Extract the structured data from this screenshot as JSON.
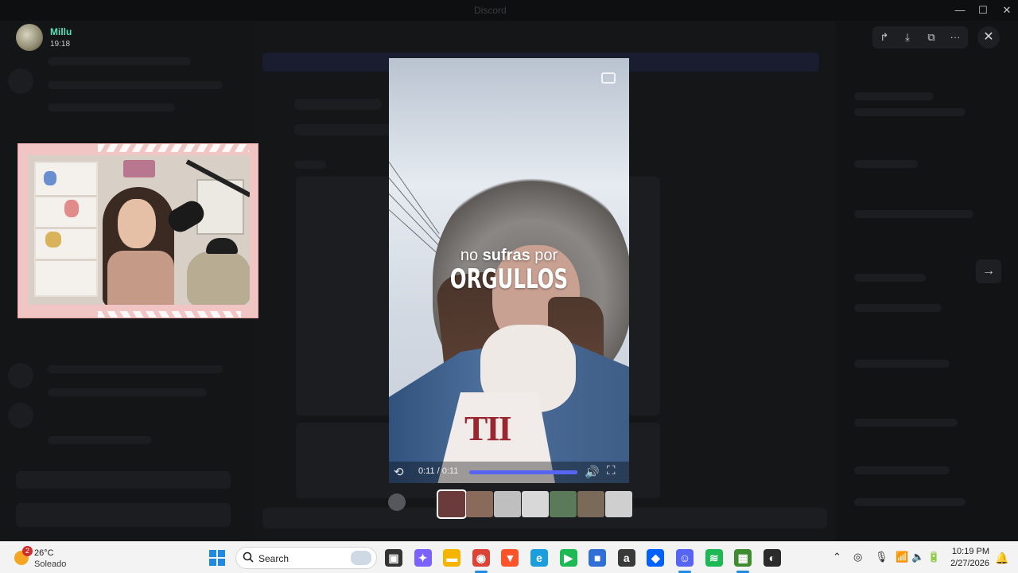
{
  "window": {
    "title": "Discord",
    "minimize": "—",
    "maximize": "☐",
    "close": "✕"
  },
  "uploader": {
    "name": "Millu",
    "time": "19:18"
  },
  "viewer": {
    "toolbar": {
      "forward": "↱",
      "download": "⤓",
      "open_external": "⧉",
      "more": "···"
    },
    "close": "✕",
    "next": "→"
  },
  "video": {
    "caption_line1_a": "no",
    "caption_line1_b": "sufras",
    "caption_line1_c": "por",
    "caption_line2": "ORGULLOS",
    "shirt_text": "TII",
    "current_time": "0:11",
    "duration": "0:11",
    "time_display": "0:11 / 0:11",
    "progress": 1.0
  },
  "thumbnails": [
    {
      "name": "thumb-1",
      "color": "#6b3b3b",
      "active": true
    },
    {
      "name": "thumb-2",
      "color": "#8a6a5a",
      "active": false
    },
    {
      "name": "thumb-3",
      "color": "#bfbfbf",
      "active": false
    },
    {
      "name": "thumb-4",
      "color": "#d8d8d8",
      "active": false
    },
    {
      "name": "thumb-5",
      "color": "#5a7a5a",
      "active": false
    },
    {
      "name": "thumb-6",
      "color": "#7a6a5a",
      "active": false
    },
    {
      "name": "thumb-7",
      "color": "#cfcfcf",
      "active": false
    }
  ],
  "taskbar": {
    "weather": {
      "badge": "2",
      "temp": "26°C",
      "condition": "Soleado"
    },
    "search_placeholder": "Search",
    "apps": [
      {
        "name": "task-view-icon",
        "color": "#333333",
        "glyph": "▣"
      },
      {
        "name": "copilot-icon",
        "color": "#7b61ff",
        "glyph": "✦"
      },
      {
        "name": "file-explorer-icon",
        "color": "#f4b400",
        "glyph": "▬"
      },
      {
        "name": "chrome-icon",
        "color": "#db4437",
        "glyph": "◉"
      },
      {
        "name": "brave-icon",
        "color": "#fb542b",
        "glyph": "▼"
      },
      {
        "name": "edge-icon",
        "color": "#1a9ede",
        "glyph": "e"
      },
      {
        "name": "app-green-icon",
        "color": "#1db954",
        "glyph": "▶"
      },
      {
        "name": "store-icon",
        "color": "#2f6fd6",
        "glyph": "■"
      },
      {
        "name": "amazon-icon",
        "color": "#3a3a3a",
        "glyph": "a"
      },
      {
        "name": "dropbox-icon",
        "color": "#0061fe",
        "glyph": "◆"
      },
      {
        "name": "discord-icon",
        "color": "#5865f2",
        "glyph": "☺"
      },
      {
        "name": "spotify-icon",
        "color": "#1db954",
        "glyph": "≋"
      },
      {
        "name": "minecraft-icon",
        "color": "#3f8b2f",
        "glyph": "▦"
      },
      {
        "name": "obs-icon",
        "color": "#2b2b2b",
        "glyph": "◐"
      }
    ],
    "clock_time": "10:19 PM",
    "clock_date": "2/27/2026"
  },
  "colors": {
    "accent": "#5865f2",
    "username": "#5ce0b4"
  }
}
